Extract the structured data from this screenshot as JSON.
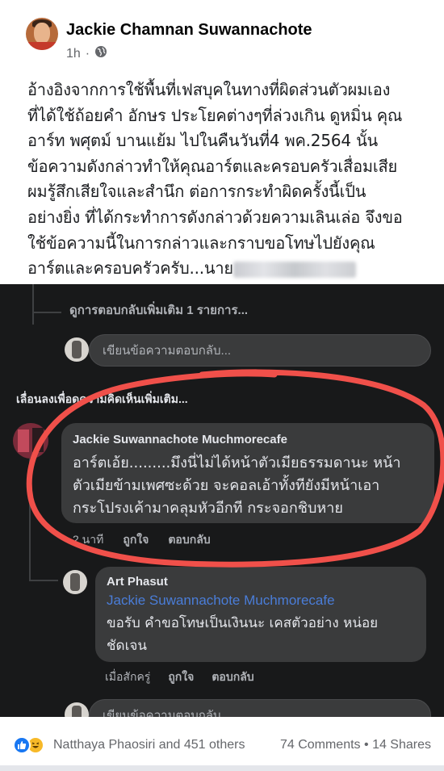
{
  "post": {
    "author": "Jackie Chamnan Suwannachote",
    "time": "1h",
    "privacy_icon": "globe-icon",
    "text_lines": [
      "อ้างอิงจากการใช้พื้นที่เฟสบุคในทางที่ผิดส่วนตัวผมเอง",
      "ที่ได้ใช้ถ้อยคำ อักษร ประโยคต่างๆที่ล่วงเกิน ดูหมิ่น คุณ",
      "อาร์ท พศุตม์ บานแย้ม ไปในคืนวันที่4 พค.2564 นั้น",
      "ข้อความดังกล่าวทำให้คุณอาร์ตและครอบครัวเสื่อมเสีย",
      "ผมรู้สึกเสียใจและสำนึก ต่อการกระทำผิดครั้งนี้เป็น",
      "อย่างยิ่ง ที่ได้กระทำการดังกล่าวด้วยความเลินเล่อ จึงขอ",
      "ใช้ข้อความนี้ในการกล่าวและกราบขอโทษไปยังคุณ",
      "อาร์ตและครอบครัวครับ...นาย"
    ]
  },
  "screenshot": {
    "more_replies": "ดูการตอบกลับเพิ่มเติม 1 รายการ...",
    "reply_placeholder": "เขียนข้อความตอบกลับ...",
    "scroll_hint": "เลื่อนลงเพื่อดูความคิดเห็นเพิ่มเติม...",
    "comment": {
      "name": "Jackie Suwannachote Muchmorecafe",
      "lines": [
        "อาร์ตเอ้ย.........มึงนี่ไม่ได้หน้าตัวเมียธรรมดานะ หน้า",
        "ตัวเมียข้ามเพศซะด้วย จะคอลเอ้าทั้งทียังมีหน้าเอา",
        "กระโปรงเค้ามาคลุมหัวอีกที กระจอกชิบหาย"
      ],
      "time": "2 นาที",
      "like": "ถูกใจ",
      "reply": "ตอบกลับ"
    },
    "reply": {
      "name": "Art Phasut",
      "mention": "Jackie Suwannachote Muchmorecafe",
      "lines": [
        "ขอรับ คำขอโทษเป็นเงินนะ เคสตัวอย่าง หน่อย",
        "ชัดเจน"
      ],
      "time": "เมื่อสักครู่",
      "like": "ถูกใจ",
      "reply": "ตอบกลับ"
    },
    "annotation_color": "#f0504a"
  },
  "footer": {
    "reaction_icons": [
      "like-icon",
      "haha-icon"
    ],
    "reacted_by": "Natthaya Phaosiri and 451 others",
    "comments": "74 Comments",
    "separator": "•",
    "shares": "14 Shares"
  }
}
